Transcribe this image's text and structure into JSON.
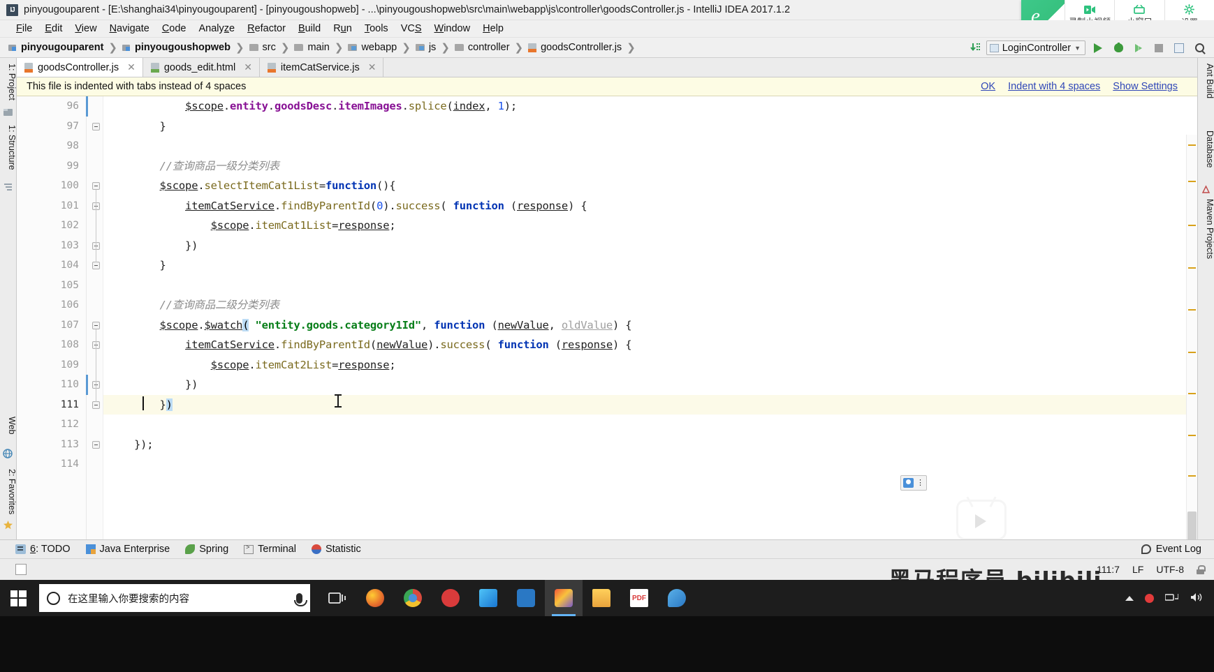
{
  "window": {
    "title": "pinyougouparent - [E:\\shanghai34\\pinyougouparent] - [pinyougoushopweb] - ...\\pinyougoushopweb\\src\\main\\webapp\\js\\controller\\goodsController.js - IntelliJ IDEA 2017.1.2",
    "app_icon": "intellij-idea-icon"
  },
  "recorder_overlay": {
    "logo": "ie-browser-icon",
    "items": [
      {
        "label": "录制小视频",
        "icon": "video-record-icon"
      },
      {
        "label": "小窗口",
        "icon": "mini-window-icon"
      },
      {
        "label": "设置",
        "icon": "gear-icon"
      }
    ]
  },
  "menu": [
    {
      "label": "File",
      "mnemonic": "F"
    },
    {
      "label": "Edit",
      "mnemonic": "E"
    },
    {
      "label": "View",
      "mnemonic": "V"
    },
    {
      "label": "Navigate",
      "mnemonic": "N"
    },
    {
      "label": "Code",
      "mnemonic": "C"
    },
    {
      "label": "Analyze",
      "mnemonic": "z"
    },
    {
      "label": "Refactor",
      "mnemonic": "R"
    },
    {
      "label": "Build",
      "mnemonic": "B"
    },
    {
      "label": "Run",
      "mnemonic": "u"
    },
    {
      "label": "Tools",
      "mnemonic": "T"
    },
    {
      "label": "VCS",
      "mnemonic": "S"
    },
    {
      "label": "Window",
      "mnemonic": "W"
    },
    {
      "label": "Help",
      "mnemonic": "H"
    }
  ],
  "breadcrumbs": [
    {
      "label": "pinyougouparent",
      "icon": "module-icon",
      "bold": true
    },
    {
      "label": "pinyougoushopweb",
      "icon": "module-icon",
      "bold": true
    },
    {
      "label": "src",
      "icon": "folder-icon",
      "bold": false
    },
    {
      "label": "main",
      "icon": "folder-icon",
      "bold": false
    },
    {
      "label": "webapp",
      "icon": "folder-blue-icon",
      "bold": false
    },
    {
      "label": "js",
      "icon": "folder-blue-icon",
      "bold": false
    },
    {
      "label": "controller",
      "icon": "folder-icon",
      "bold": false
    },
    {
      "label": "goodsController.js",
      "icon": "js-file-icon",
      "bold": false
    }
  ],
  "toolbar": {
    "update_icon": "update-project-icon",
    "run_config": "LoginController",
    "run_label": "Run",
    "debug_label": "Debug",
    "coverage_label": "Run with Coverage",
    "stop_label": "Stop",
    "database_label": "Database",
    "search_label": "Search Everywhere"
  },
  "tabs": [
    {
      "label": "goodsController.js",
      "icon": "js-file-icon",
      "active": true
    },
    {
      "label": "goods_edit.html",
      "icon": "html-file-icon",
      "active": false
    },
    {
      "label": "itemCatService.js",
      "icon": "js-file-icon",
      "active": false
    }
  ],
  "banner": {
    "message": "This file is indented with tabs instead of 4 spaces",
    "links": [
      "OK",
      "Indent with 4 spaces",
      "Show Settings"
    ]
  },
  "left_tool_window": [
    {
      "label": "1: Project",
      "icon": "project-icon"
    },
    {
      "label": "1: Structure",
      "icon": "structure-icon"
    },
    {
      "label": "Web",
      "icon": "web-icon"
    },
    {
      "label": "2: Favorites",
      "icon": "favorites-star-icon"
    }
  ],
  "right_tool_window": [
    {
      "label": "Ant Build",
      "icon": "ant-icon"
    },
    {
      "label": "Database",
      "icon": "database-icon"
    },
    {
      "label": "Maven Projects",
      "icon": "maven-icon"
    }
  ],
  "bottom_tool_window": [
    {
      "label": "6: TODO",
      "mnemonic": "6",
      "icon": "todo-icon"
    },
    {
      "label": "Java Enterprise",
      "icon": "java-enterprise-icon"
    },
    {
      "label": "Spring",
      "icon": "spring-leaf-icon"
    },
    {
      "label": "Terminal",
      "icon": "terminal-icon"
    },
    {
      "label": "Statistic",
      "icon": "statistic-icon"
    }
  ],
  "event_log": {
    "label": "Event Log",
    "icon": "event-log-icon"
  },
  "status_bar": {
    "caret_position": "111:7",
    "line_separator": "LF",
    "encoding": "UTF-8",
    "lock_icon": "lock-icon"
  },
  "watermark": "黑马程序员 bilibili",
  "editor": {
    "first_visible_line": 96,
    "current_line": 111,
    "lines": [
      {
        "no": 96,
        "fold": false,
        "tokens": [
          {
            "t": "        ",
            "c": "s-pun"
          },
          {
            "t": "$scope",
            "c": "s-var"
          },
          {
            "t": ".",
            "c": "s-pun"
          },
          {
            "t": "entity",
            "c": "s-field"
          },
          {
            "t": ".",
            "c": "s-pun"
          },
          {
            "t": "goodsDesc",
            "c": "s-field"
          },
          {
            "t": ".",
            "c": "s-pun"
          },
          {
            "t": "itemImages",
            "c": "s-field"
          },
          {
            "t": ".",
            "c": "s-pun"
          },
          {
            "t": "splice",
            "c": "s-prop"
          },
          {
            "t": "(",
            "c": "s-pun"
          },
          {
            "t": "index",
            "c": "s-param"
          },
          {
            "t": ", ",
            "c": "s-pun"
          },
          {
            "t": "1",
            "c": "s-num"
          },
          {
            "t": ");",
            "c": "s-pun"
          }
        ]
      },
      {
        "no": 97,
        "fold": true,
        "tokens": [
          {
            "t": "    }",
            "c": "s-pun"
          }
        ]
      },
      {
        "no": 98,
        "fold": false,
        "tokens": []
      },
      {
        "no": 99,
        "fold": false,
        "tokens": [
          {
            "t": "    //查询商品一级分类列表",
            "c": "s-cmt"
          }
        ]
      },
      {
        "no": 100,
        "fold": true,
        "tokens": [
          {
            "t": "    ",
            "c": "s-pun"
          },
          {
            "t": "$scope",
            "c": "s-var"
          },
          {
            "t": ".",
            "c": "s-pun"
          },
          {
            "t": "selectItemCat1List",
            "c": "s-prop"
          },
          {
            "t": "=",
            "c": "s-pun"
          },
          {
            "t": "function",
            "c": "s-kw"
          },
          {
            "t": "(){",
            "c": "s-pun"
          }
        ]
      },
      {
        "no": 101,
        "fold": true,
        "tokens": [
          {
            "t": "        ",
            "c": "s-pun"
          },
          {
            "t": "itemCatService",
            "c": "s-var"
          },
          {
            "t": ".",
            "c": "s-pun"
          },
          {
            "t": "findByParentId",
            "c": "s-prop"
          },
          {
            "t": "(",
            "c": "s-pun"
          },
          {
            "t": "0",
            "c": "s-num"
          },
          {
            "t": ").",
            "c": "s-pun"
          },
          {
            "t": "success",
            "c": "s-prop"
          },
          {
            "t": "( ",
            "c": "s-pun"
          },
          {
            "t": "function",
            "c": "s-kw"
          },
          {
            "t": " (",
            "c": "s-pun"
          },
          {
            "t": "response",
            "c": "s-param"
          },
          {
            "t": ") {",
            "c": "s-pun"
          }
        ]
      },
      {
        "no": 102,
        "fold": false,
        "tokens": [
          {
            "t": "            ",
            "c": "s-pun"
          },
          {
            "t": "$scope",
            "c": "s-var"
          },
          {
            "t": ".",
            "c": "s-pun"
          },
          {
            "t": "itemCat1List",
            "c": "s-prop"
          },
          {
            "t": "=",
            "c": "s-pun"
          },
          {
            "t": "response",
            "c": "s-param"
          },
          {
            "t": ";",
            "c": "s-pun"
          }
        ]
      },
      {
        "no": 103,
        "fold": true,
        "tokens": [
          {
            "t": "        })",
            "c": "s-pun"
          }
        ]
      },
      {
        "no": 104,
        "fold": true,
        "tokens": [
          {
            "t": "    }",
            "c": "s-pun"
          }
        ]
      },
      {
        "no": 105,
        "fold": false,
        "tokens": []
      },
      {
        "no": 106,
        "fold": false,
        "tokens": [
          {
            "t": "    //查询商品二级分类列表",
            "c": "s-cmt"
          }
        ]
      },
      {
        "no": 107,
        "fold": true,
        "tokens": [
          {
            "t": "    ",
            "c": "s-pun"
          },
          {
            "t": "$scope",
            "c": "s-var"
          },
          {
            "t": ".",
            "c": "s-pun"
          },
          {
            "t": "$watch",
            "c": "s-var"
          },
          {
            "t": "(",
            "c": "s-match"
          },
          {
            "t": " ",
            "c": "s-pun"
          },
          {
            "t": "\"entity.goods.category1Id\"",
            "c": "s-str"
          },
          {
            "t": ", ",
            "c": "s-pun"
          },
          {
            "t": "function",
            "c": "s-kw"
          },
          {
            "t": " (",
            "c": "s-pun"
          },
          {
            "t": "newValue",
            "c": "s-param"
          },
          {
            "t": ", ",
            "c": "s-pun"
          },
          {
            "t": "oldValue",
            "c": "s-unused"
          },
          {
            "t": ") {",
            "c": "s-pun"
          }
        ]
      },
      {
        "no": 108,
        "fold": true,
        "tokens": [
          {
            "t": "        ",
            "c": "s-pun"
          },
          {
            "t": "itemCatService",
            "c": "s-var"
          },
          {
            "t": ".",
            "c": "s-pun"
          },
          {
            "t": "findByParentId",
            "c": "s-prop"
          },
          {
            "t": "(",
            "c": "s-pun"
          },
          {
            "t": "newValue",
            "c": "s-param"
          },
          {
            "t": ").",
            "c": "s-pun"
          },
          {
            "t": "success",
            "c": "s-prop"
          },
          {
            "t": "( ",
            "c": "s-pun"
          },
          {
            "t": "function",
            "c": "s-kw"
          },
          {
            "t": " (",
            "c": "s-pun"
          },
          {
            "t": "response",
            "c": "s-param"
          },
          {
            "t": ") {",
            "c": "s-pun"
          }
        ]
      },
      {
        "no": 109,
        "fold": false,
        "tokens": [
          {
            "t": "            ",
            "c": "s-pun"
          },
          {
            "t": "$scope",
            "c": "s-var"
          },
          {
            "t": ".",
            "c": "s-pun"
          },
          {
            "t": "itemCat2List",
            "c": "s-prop"
          },
          {
            "t": "=",
            "c": "s-pun"
          },
          {
            "t": "response",
            "c": "s-param"
          },
          {
            "t": ";",
            "c": "s-pun"
          }
        ]
      },
      {
        "no": 110,
        "fold": true,
        "tokens": [
          {
            "t": "        })",
            "c": "s-pun"
          }
        ]
      },
      {
        "no": 111,
        "fold": true,
        "current": true,
        "tokens": [
          {
            "t": "    }",
            "c": "s-pun"
          },
          {
            "t": ")",
            "c": "s-match"
          }
        ]
      },
      {
        "no": 112,
        "fold": false,
        "tokens": []
      },
      {
        "no": 113,
        "fold": true,
        "tokens": [
          {
            "t": "});",
            "c": "s-pun"
          }
        ]
      },
      {
        "no": 114,
        "fold": false,
        "tokens": []
      }
    ]
  },
  "taskbar": {
    "start_icon": "windows-start-icon",
    "search_placeholder": "在这里输入你要搜索的内容",
    "search_icon": "cortana-circle-icon",
    "mic_icon": "microphone-icon",
    "task_view_icon": "task-view-icon",
    "apps": [
      {
        "name": "firefox-icon",
        "color": "#e8742c"
      },
      {
        "name": "chrome-icon",
        "color": "#4a90d9"
      },
      {
        "name": "opera-icon",
        "color": "#d93b3b"
      },
      {
        "name": "navicat-icon",
        "color": "#3aa3d9"
      },
      {
        "name": "vm-icon",
        "color": "#3a8fd9"
      },
      {
        "name": "intellij-idea-icon",
        "color": "#7a5ac8",
        "active": true
      },
      {
        "name": "explorer-icon",
        "color": "#e8b33d"
      },
      {
        "name": "pdf-icon",
        "color": "#d93b3b"
      },
      {
        "name": "editor-icon",
        "color": "#3a8fd9"
      }
    ],
    "tray": [
      "caret-up-icon",
      "red-dot-icon",
      "network-icon",
      "volume-icon"
    ]
  }
}
